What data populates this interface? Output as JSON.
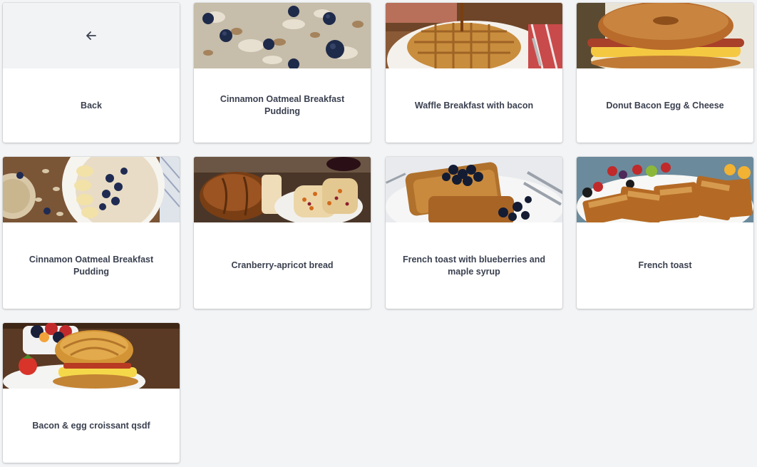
{
  "back": {
    "label": "Back",
    "icon": "arrow-left-icon"
  },
  "recipes": [
    {
      "title": "Cinnamon Oatmeal Breakfast Pudding",
      "image": "oatmeal-blueberries-photo"
    },
    {
      "title": "Waffle Breakfast with bacon",
      "image": "waffle-photo"
    },
    {
      "title": "Donut Bacon Egg & Cheese",
      "image": "bagel-sandwich-photo"
    },
    {
      "title": "Cinnamon Oatmeal Breakfast Pudding",
      "image": "oatmeal-bowl-photo"
    },
    {
      "title": "Cranberry-apricot bread",
      "image": "bread-photo"
    },
    {
      "title": "French toast with blueberries and maple syrup",
      "image": "french-toast-blueberries-photo"
    },
    {
      "title": "French toast",
      "image": "french-toast-photo"
    },
    {
      "title": "Bacon & egg croissant qsdf",
      "image": "croissant-photo"
    }
  ],
  "colors": {
    "page_background": "#f3f4f6",
    "card_background": "#ffffff",
    "label_text": "#3b4150",
    "back_thumb_background": "#f2f3f5"
  }
}
